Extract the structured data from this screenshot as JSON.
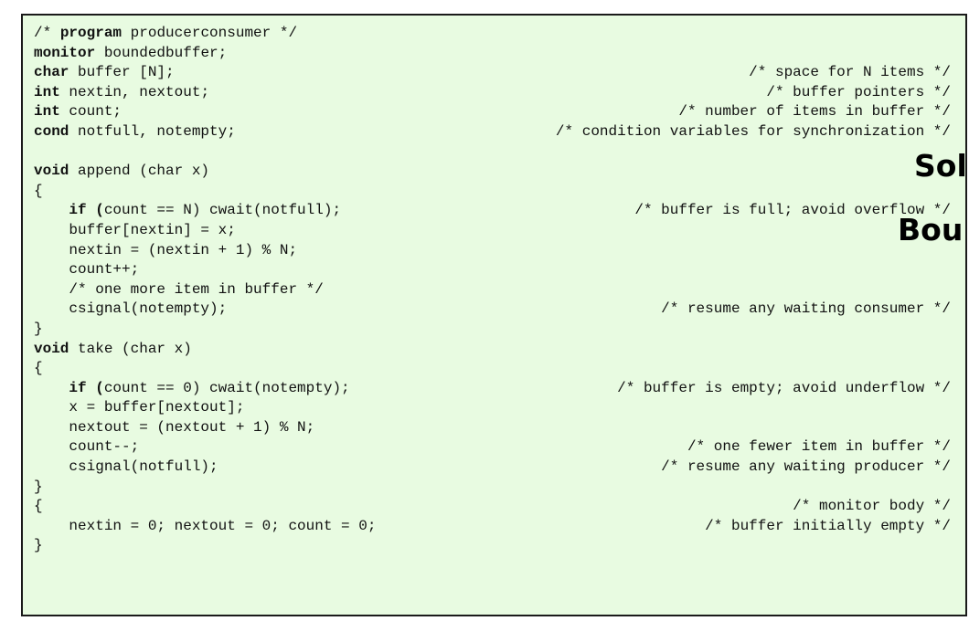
{
  "code_listing": {
    "lines": [
      {
        "kw1": "/* ",
        "kw": "program",
        "text": " producerconsumer */",
        "comment": ""
      },
      {
        "kw1": "",
        "kw": "monitor",
        "text": " boundedbuffer;",
        "comment": ""
      },
      {
        "kw1": "",
        "kw": "char",
        "text": " buffer [N];",
        "comment": "/* space for N items */"
      },
      {
        "kw1": "",
        "kw": "int",
        "text": " nextin, nextout;",
        "comment": "/* buffer pointers */"
      },
      {
        "kw1": "",
        "kw": "int",
        "text": " count;",
        "comment": "/* number of items in buffer */"
      },
      {
        "kw1": "",
        "kw": "cond",
        "text": " notfull, notempty;",
        "comment": "/* condition variables for synchronization */"
      },
      {
        "kw1": "",
        "kw": "",
        "text": "",
        "comment": ""
      },
      {
        "kw1": "",
        "kw": "void",
        "text": " append (char x)",
        "comment": ""
      },
      {
        "kw1": "",
        "kw": "",
        "text": "{",
        "comment": ""
      },
      {
        "kw1": "    ",
        "kw": "if (",
        "text": "count == N) cwait(notfull);",
        "comment": "/* buffer is full; avoid overflow */"
      },
      {
        "kw1": "    ",
        "kw": "",
        "text": "buffer[nextin] = x;",
        "comment": ""
      },
      {
        "kw1": "    ",
        "kw": "",
        "text": "nextin = (nextin + 1) % N;",
        "comment": ""
      },
      {
        "kw1": "    ",
        "kw": "",
        "text": "count++;",
        "comment": ""
      },
      {
        "kw1": "    ",
        "kw": "",
        "text": "/* one more item in buffer */",
        "comment": ""
      },
      {
        "kw1": "    ",
        "kw": "",
        "text": "csignal(notempty);",
        "comment": "/* resume any waiting consumer */"
      },
      {
        "kw1": "",
        "kw": "",
        "text": "}",
        "comment": ""
      },
      {
        "kw1": "",
        "kw": "void",
        "text": " take (char x)",
        "comment": ""
      },
      {
        "kw1": "",
        "kw": "",
        "text": "{",
        "comment": ""
      },
      {
        "kw1": "    ",
        "kw": "if (",
        "text": "count == 0) cwait(notempty);",
        "comment": "/* buffer is empty; avoid underflow */"
      },
      {
        "kw1": "    ",
        "kw": "",
        "text": "x = buffer[nextout];",
        "comment": ""
      },
      {
        "kw1": "    ",
        "kw": "",
        "text": "nextout = (nextout + 1) % N;",
        "comment": ""
      },
      {
        "kw1": "    ",
        "kw": "",
        "text": "count--;",
        "comment": "/* one fewer item in buffer */"
      },
      {
        "kw1": "    ",
        "kw": "",
        "text": "csignal(notfull);",
        "comment": "/* resume any waiting producer */"
      },
      {
        "kw1": "",
        "kw": "",
        "text": "}",
        "comment": ""
      },
      {
        "kw1": "",
        "kw": "",
        "text": "{",
        "comment": "/* monitor body */"
      },
      {
        "kw1": "    ",
        "kw": "",
        "text": "nextin = 0; nextout = 0; count = 0;",
        "comment": "/* buffer initially empty */"
      },
      {
        "kw1": "",
        "kw": "",
        "text": "}",
        "comment": ""
      }
    ]
  },
  "overlay": {
    "title_line_1": "Sol",
    "title_line_2": "Bou"
  }
}
